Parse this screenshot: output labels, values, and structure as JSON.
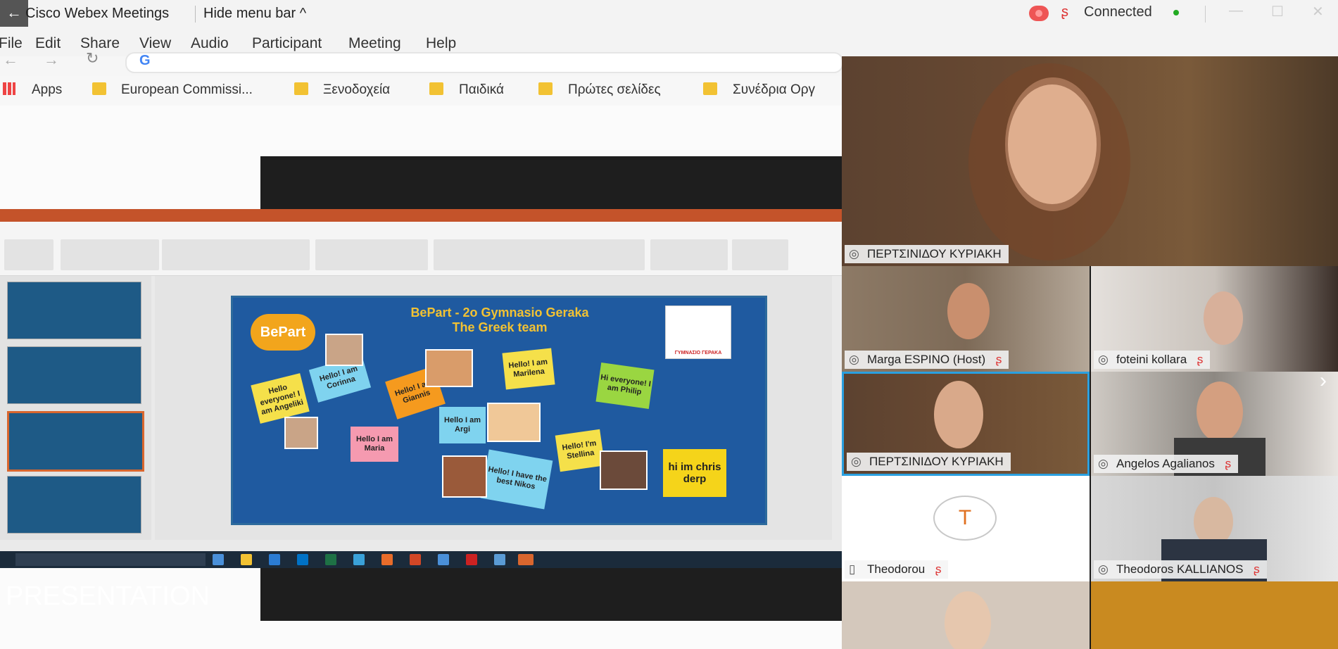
{
  "titlebar": {
    "back": "←",
    "app_title": "Cisco Webex Meetings",
    "hide_menu": "Hide menu bar ^",
    "status": "Connected",
    "minimize": "—",
    "maximize": "☐",
    "close": "✕"
  },
  "menu": [
    "File",
    "Edit",
    "Share",
    "View",
    "Audio",
    "Participant",
    "Meeting",
    "Help"
  ],
  "browser": {
    "bookmarks": [
      "Apps",
      "European Commissi...",
      "Ξενοδοχεία",
      "Παιδικά",
      "Πρώτες σελίδες",
      "Συνέδρια Οργ"
    ]
  },
  "slide": {
    "title_line1": "BePart - 2o Gymnasio Geraka",
    "title_line2": "The Greek team",
    "logo": "BePart",
    "partner_logo": "ΓΥΜΝΑΣΙΟ ΓΕΡΑΚΑ",
    "notes": [
      {
        "text": "Hello everyone! I am Angeliki",
        "color": "#f5e04a"
      },
      {
        "text": "Hello! I am Corinna",
        "color": "#7fd3ef"
      },
      {
        "text": "Hello! I am Giannis",
        "color": "#f59a1e"
      },
      {
        "text": "Hello! I am Marilena",
        "color": "#f5e04a"
      },
      {
        "text": "Hi everyone! I am Philip",
        "color": "#9ad641"
      },
      {
        "text": "Hello I am Argi",
        "color": "#7fd3ef"
      },
      {
        "text": "Hello I am Maria",
        "color": "#f59ab0"
      },
      {
        "text": "Hello! I'm Stellina",
        "color": "#f5e04a"
      },
      {
        "text": "Hello! I have the best Nikos",
        "color": "#7fd3ef"
      },
      {
        "text": "hi im chris derp",
        "color": "#f5d41a"
      }
    ]
  },
  "share_label": "PRESENTATION",
  "participants": [
    {
      "name": "ΠΕΡΤΣΙΝΙΔΟΥ ΚΥΡΙΑΚΗ",
      "icon": "headset-icon",
      "muted": false,
      "bg": "#6a4a32"
    },
    {
      "name": "Marga ESPINO (Host)",
      "icon": "headset-icon",
      "muted": true,
      "bg": "#7d6a57"
    },
    {
      "name": "foteini kollara",
      "icon": "headset-icon",
      "muted": true,
      "bg": "#c9c2bb"
    },
    {
      "name": "ΠΕΡΤΣΙΝΙΔΟΥ ΚΥΡΙΑΚΗ",
      "icon": "headset-icon",
      "muted": false,
      "bg": "#6a4a32"
    },
    {
      "name": "Angelos Agalianos",
      "icon": "headset-icon",
      "muted": true,
      "bg": "#8d8882"
    },
    {
      "name": "Theodorou",
      "icon": "phone-icon",
      "muted": true,
      "bg": "#ffffff"
    },
    {
      "name": "Theodoros KALLIANOS",
      "icon": "headset-icon",
      "muted": true,
      "bg": "#d8d8d8"
    }
  ],
  "avatar_letter": "T",
  "colors": {
    "accent": "#f2c233",
    "ppt_bar": "#c4532a",
    "slide_bg": "#1f5aa0"
  }
}
